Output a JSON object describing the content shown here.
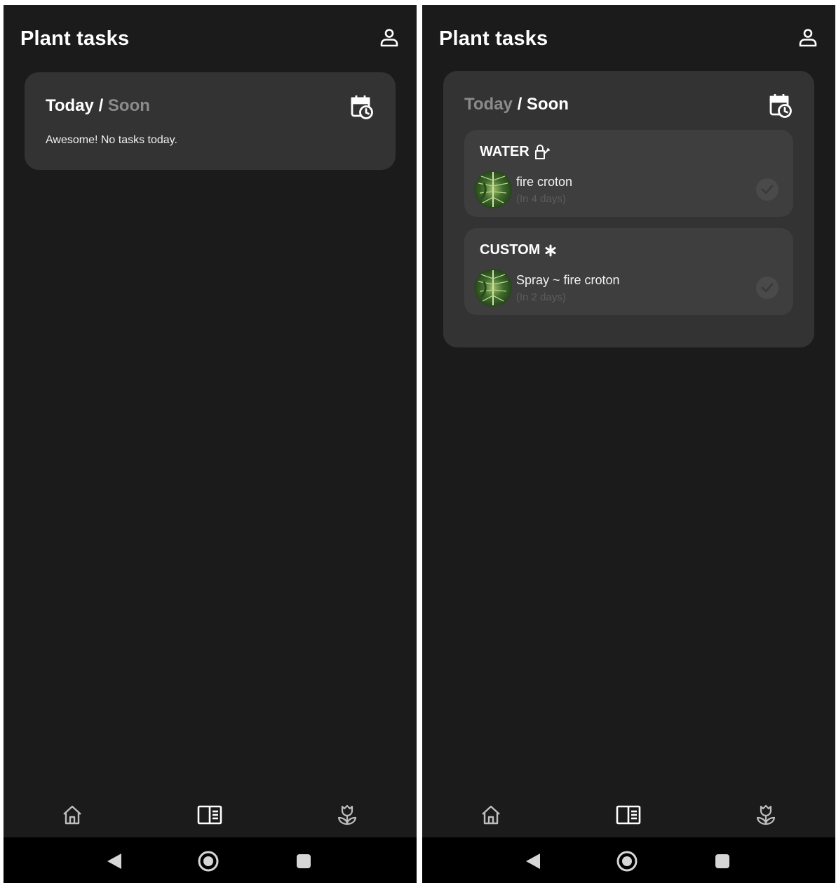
{
  "colors": {
    "background": "#1b1b1b",
    "card": "#333333",
    "group": "#3e3e3e",
    "text": "#ffffff",
    "muted": "#8b8b8b",
    "system_bar": "#000000"
  },
  "screens": [
    {
      "header": {
        "title": "Plant tasks",
        "profile_icon": "user-icon"
      },
      "card": {
        "tab_today": "Today",
        "separator": "/",
        "tab_soon": "Soon",
        "active_tab": "Today",
        "calendar_icon": "calendar-clock-icon",
        "empty_message": "Awesome! No tasks today."
      },
      "nav": {
        "items": [
          "home-icon",
          "tasks-icon",
          "plants-icon"
        ],
        "active": "tasks-icon"
      },
      "system": {
        "buttons": [
          "back",
          "home",
          "recents"
        ]
      }
    },
    {
      "header": {
        "title": "Plant tasks",
        "profile_icon": "user-icon"
      },
      "card": {
        "tab_today": "Today",
        "separator": "/",
        "tab_soon": "Soon",
        "active_tab": "Soon",
        "calendar_icon": "calendar-clock-icon",
        "groups": [
          {
            "title": "WATER",
            "icon": "watering-can-icon",
            "task": {
              "name": "fire croton",
              "due": "(In 4 days)"
            }
          },
          {
            "title": "CUSTOM",
            "icon": "asterisk-icon",
            "task": {
              "name": "Spray ~ fire croton",
              "due": "(In 2 days)"
            }
          }
        ]
      },
      "nav": {
        "items": [
          "home-icon",
          "tasks-icon",
          "plants-icon"
        ],
        "active": "tasks-icon"
      },
      "system": {
        "buttons": [
          "back",
          "home",
          "recents"
        ]
      }
    }
  ]
}
